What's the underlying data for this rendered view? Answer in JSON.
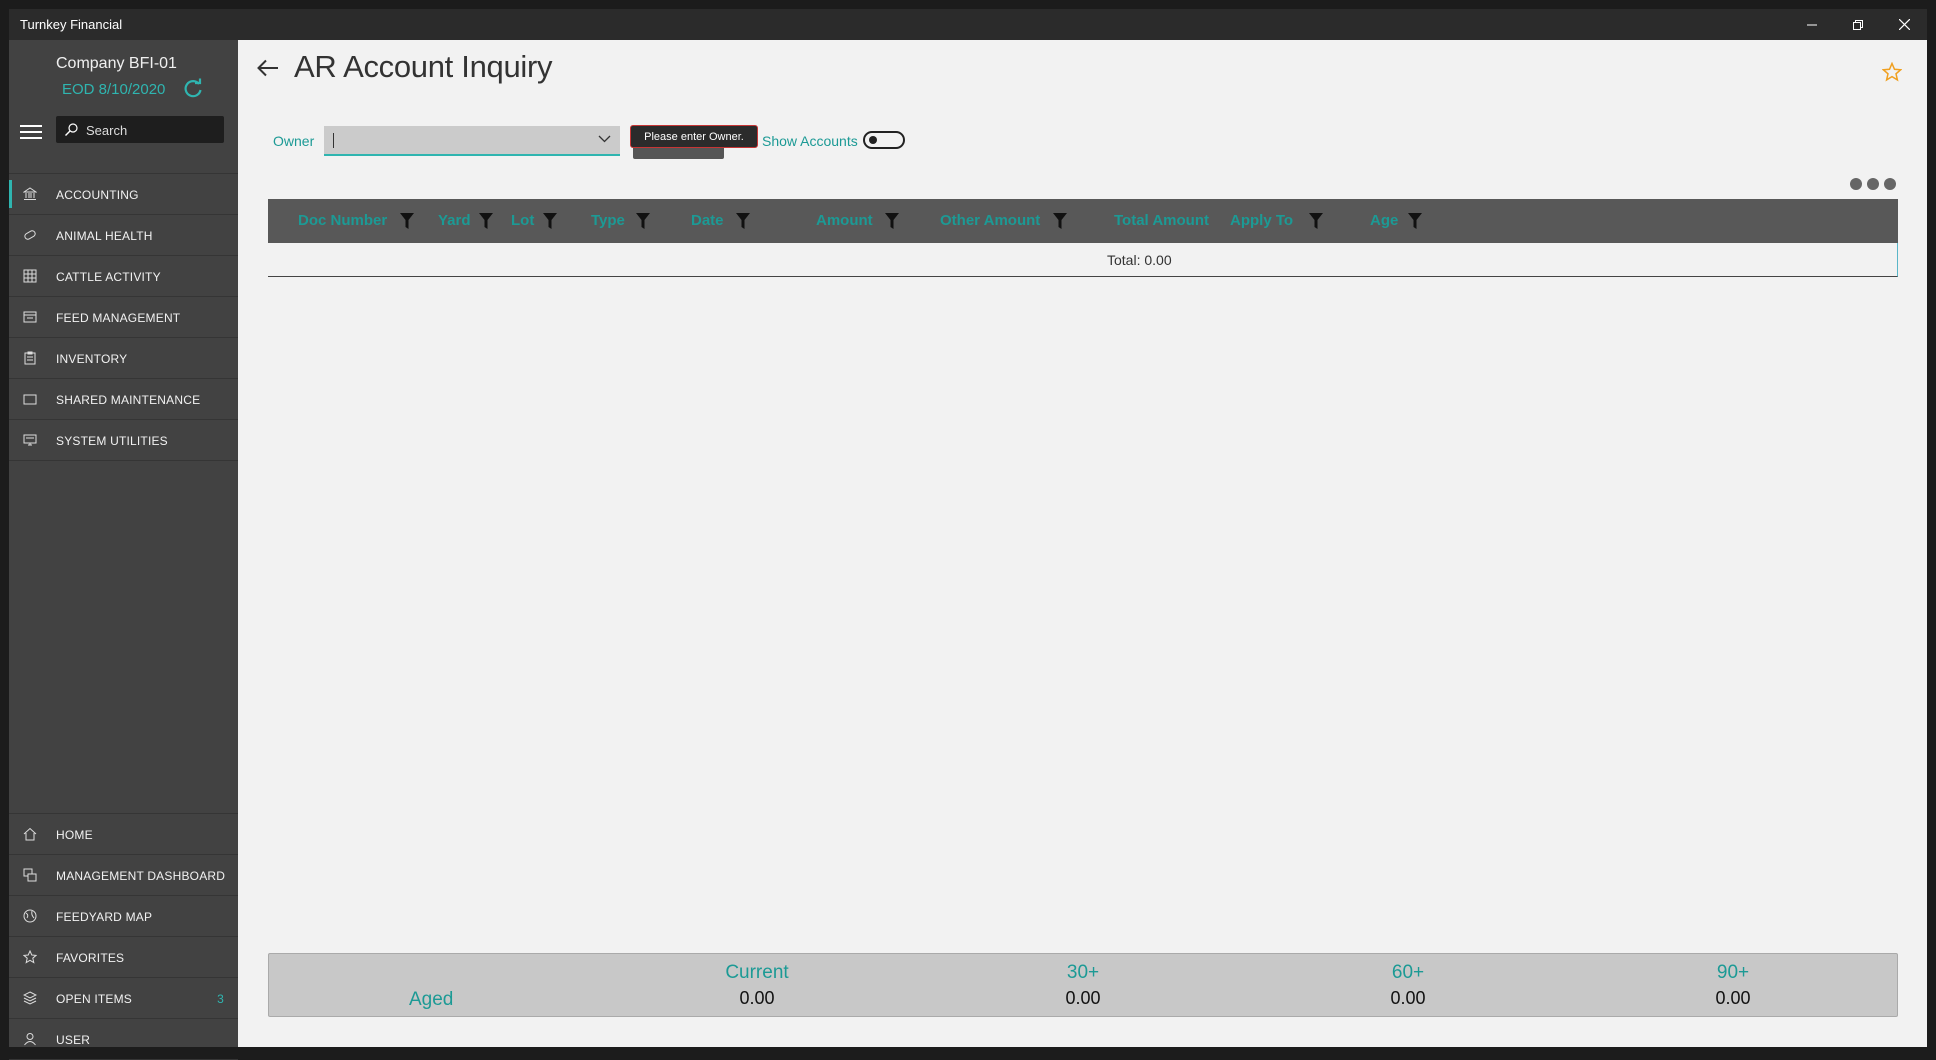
{
  "window": {
    "title": "Turnkey Financial"
  },
  "sidebar": {
    "company": "Company BFI-01",
    "eod": "EOD 8/10/2020",
    "search_placeholder": "Search",
    "nav_top": [
      {
        "label": "ACCOUNTING",
        "icon": "bank-icon"
      },
      {
        "label": "ANIMAL HEALTH",
        "icon": "pill-icon"
      },
      {
        "label": "CATTLE ACTIVITY",
        "icon": "grid-icon"
      },
      {
        "label": "FEED MANAGEMENT",
        "icon": "feed-icon"
      },
      {
        "label": "INVENTORY",
        "icon": "clipboard-icon"
      },
      {
        "label": "SHARED MAINTENANCE",
        "icon": "folder-icon"
      },
      {
        "label": "SYSTEM UTILITIES",
        "icon": "monitor-icon"
      }
    ],
    "nav_bottom": [
      {
        "label": "HOME",
        "icon": "home-icon"
      },
      {
        "label": "MANAGEMENT DASHBOARD",
        "icon": "dashboard-icon"
      },
      {
        "label": "FEEDYARD MAP",
        "icon": "globe-icon"
      },
      {
        "label": "FAVORITES",
        "icon": "star-icon"
      },
      {
        "label": "OPEN ITEMS",
        "icon": "layers-icon",
        "count": "3"
      },
      {
        "label": "USER",
        "icon": "user-icon"
      }
    ]
  },
  "page": {
    "title": "AR Account Inquiry",
    "owner_label": "Owner",
    "owner_value": "",
    "tooltip": "Please enter Owner.",
    "show_accounts_label": "Show Accounts",
    "show_accounts_on": false
  },
  "grid": {
    "columns": [
      "Doc Number",
      "Yard",
      "Lot",
      "Type",
      "Date",
      "Amount",
      "Other Amount",
      "Total Amount",
      "Apply To",
      "Age"
    ],
    "total_label": "Total: 0.00"
  },
  "aged": {
    "label": "Aged",
    "buckets": [
      {
        "label": "Current",
        "value": "0.00"
      },
      {
        "label": "30+",
        "value": "0.00"
      },
      {
        "label": "60+",
        "value": "0.00"
      },
      {
        "label": "90+",
        "value": "0.00"
      }
    ]
  },
  "colors": {
    "accent": "#2fb5b0",
    "sidebar": "#424242",
    "titlebar": "#2b2b2b",
    "header": "#585858",
    "favorite": "#f0a020"
  }
}
